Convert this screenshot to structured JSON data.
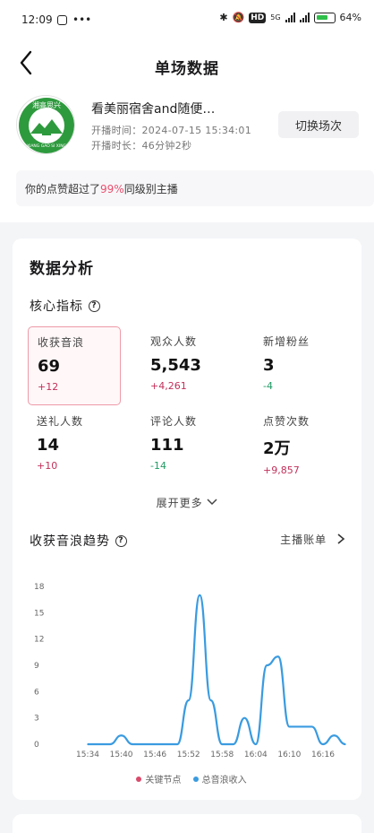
{
  "status_bar": {
    "time": "12:09",
    "battery": "64%",
    "hd": "HD",
    "network_5g": "5G"
  },
  "nav": {
    "title": "单场数据"
  },
  "stream": {
    "title": "看美丽宿舍and随便…",
    "start_time": "开播时间：2024-07-15 15:34:01",
    "duration": "开播时长：46分钟2秒",
    "switch_label": "切换场次",
    "likes_text_pre": "你的点赞超过了",
    "likes_pct": "99%",
    "likes_text_post": "同级别主播"
  },
  "analysis": {
    "title": "数据分析",
    "core_title": "核心指标",
    "metrics": [
      {
        "label": "收获音浪",
        "value": "69",
        "delta": "+12"
      },
      {
        "label": "观众人数",
        "value": "5,543",
        "delta": "+4,261"
      },
      {
        "label": "新增粉丝",
        "value": "3",
        "delta": "-4"
      },
      {
        "label": "送礼人数",
        "value": "14",
        "delta": "+10"
      },
      {
        "label": "评论人数",
        "value": "111",
        "delta": "-14"
      },
      {
        "label": "点赞次数",
        "value": "2万",
        "delta": "+9,857"
      }
    ],
    "expand_more": "展开更多",
    "trend_title": "收获音浪趋势",
    "bill_link": "主播账单"
  },
  "chart_data": {
    "type": "line",
    "x": [
      "15:34",
      "15:36",
      "15:38",
      "15:40",
      "15:42",
      "15:44",
      "15:46",
      "15:48",
      "15:50",
      "15:52",
      "15:54",
      "15:56",
      "15:58",
      "16:00",
      "16:02",
      "16:04",
      "16:06",
      "16:08",
      "16:10",
      "16:12",
      "16:14",
      "16:16",
      "16:18",
      "16:20"
    ],
    "series": [
      {
        "name": "总音浪收入",
        "values": [
          0,
          0,
          0,
          1,
          0,
          0,
          0,
          0,
          0,
          5,
          17,
          5,
          0,
          0,
          3,
          0,
          9,
          10,
          2,
          2,
          2,
          0,
          1,
          0
        ]
      }
    ],
    "key_nodes_label": "关键节点",
    "x_tick_labels": [
      "15:34",
      "15:40",
      "15:46",
      "15:52",
      "15:58",
      "16:04",
      "16:10",
      "16:16"
    ],
    "y_tick_labels": [
      "0",
      "3",
      "6",
      "9",
      "12",
      "15",
      "18"
    ],
    "ylim": [
      0,
      18
    ],
    "grid": false,
    "legend": "bottom",
    "colors": {
      "line": "#3a9be0",
      "key_node": "#d94a6a"
    }
  },
  "logo_text": {
    "top": "湘高思兴",
    "bottom": "XIANG GAO SI XING"
  }
}
